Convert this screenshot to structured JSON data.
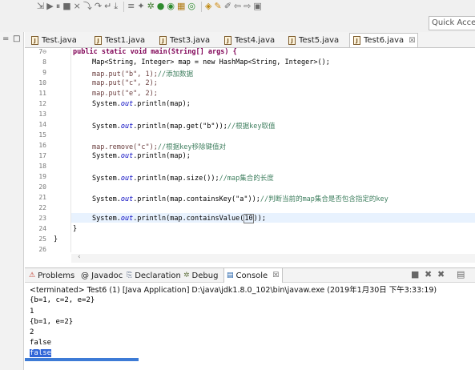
{
  "toolbar": {
    "icons": [
      "debug-step-icon",
      "resume-icon",
      "suspend-icon",
      "terminate-icon",
      "disconnect-icon",
      "step-into-icon",
      "step-over-icon",
      "step-return-icon",
      "drop-frame-icon",
      "use-step-filters-icon",
      "new-java-class-icon",
      "debug-run-icon",
      "run-icon",
      "coverage-icon",
      "new-package-icon",
      "new-interface-icon",
      "open-type-icon",
      "search-icon",
      "pin-icon",
      "back-icon",
      "forward-icon",
      "perspective-icon"
    ],
    "quick_access_placeholder": "Quick Access"
  },
  "editor_tabs": [
    {
      "label": "Test.java"
    },
    {
      "label": "Test1.java"
    },
    {
      "label": "Test3.java"
    },
    {
      "label": "Test4.java"
    },
    {
      "label": "Test5.java"
    },
    {
      "label": "Test6.java",
      "close": "☒"
    }
  ],
  "code": {
    "line_numbers": [
      "7⊖",
      "8",
      "9",
      "10",
      "11",
      "12",
      "13",
      "14",
      "15",
      "16",
      "17",
      "18",
      "19",
      "20",
      "21",
      "22",
      "23",
      "24",
      "25",
      "26"
    ],
    "l7_sig": "public static void main(String[] args) {",
    "l8_decl": "Map<String, Integer> map = new HashMap<String, Integer>();",
    "l9": "map.put(\"b\", 1);",
    "l9_comment": "//添加数据",
    "l10": "map.put(\"c\", 2);",
    "l11": "map.put(\"e\", 2);",
    "l12_a": "System.",
    "l12_b": "out",
    "l12_c": ".println(map);",
    "l14_a": "System.",
    "l14_b": "out",
    "l14_c": ".println(map.get(\"b\"));",
    "l14_comment": "//根据key取值",
    "l16": "map.remove(\"c\");",
    "l16_comment": "//根据key移除键值对",
    "l17_a": "System.",
    "l17_b": "out",
    "l17_c": ".println(map);",
    "l19_a": "System.",
    "l19_b": "out",
    "l19_c": ".println(map.size());",
    "l19_comment": "//map集合的长度",
    "l21_a": "System.",
    "l21_b": "out",
    "l21_c": ".println(map.containsKey(\"a\"));",
    "l21_comment": "//判断当前的map集合是否包含指定的key",
    "l23_a": "System.",
    "l23_b": "out",
    "l23_c": ".println(map.containsValue(",
    "l23_arg": "10",
    "l23_d": "));",
    "l24": "}",
    "l25": "}"
  },
  "console_tabs": [
    {
      "icon": "problems-icon",
      "label": "Problems"
    },
    {
      "icon": "javadoc-icon",
      "label": "@ Javadoc"
    },
    {
      "icon": "declaration-icon",
      "label": "Declaration"
    },
    {
      "icon": "debug-icon",
      "label": "Debug"
    },
    {
      "icon": "console-icon",
      "label": "Console",
      "close": "☒"
    }
  ],
  "console": {
    "terminated": "<terminated> Test6 (1) [Java Application] D:\\java\\jdk1.8.0_102\\bin\\javaw.exe (2019年1月30日 下午3:33:19)",
    "output": [
      "{b=1, c=2, e=2}",
      "1",
      "{b=1, e=2}",
      "2",
      "false",
      "false"
    ]
  },
  "progress": 0.25
}
